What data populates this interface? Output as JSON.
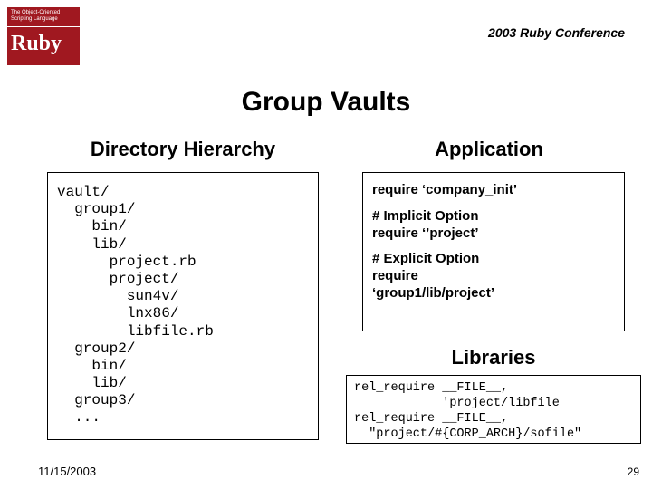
{
  "header": {
    "logo_top": "The Object-Oriented Scripting Language",
    "logo_main": "Ruby",
    "conference": "2003 Ruby Conference"
  },
  "title": "Group Vaults",
  "left": {
    "heading": "Directory Hierarchy",
    "tree": "vault/\n  group1/\n    bin/\n    lib/\n      project.rb\n      project/\n        sun4v/\n        lnx86/\n        libfile.rb\n  group2/\n    bin/\n    lib/\n  group3/\n  ..."
  },
  "right": {
    "app_heading": "Application",
    "app_l1": "require ‘company_init’",
    "app_l2": "# Implicit Option",
    "app_l3": "require ‘’project’",
    "app_l4": "# Explicit Option",
    "app_l5": "require",
    "app_l6": "‘group1/lib/project’",
    "lib_heading": "Libraries",
    "lib_body": "rel_require __FILE__,\n            'project/libfile\nrel_require __FILE__,\n  \"project/#{CORP_ARCH}/sofile\""
  },
  "footer": {
    "date": "11/15/2003",
    "page": "29"
  }
}
